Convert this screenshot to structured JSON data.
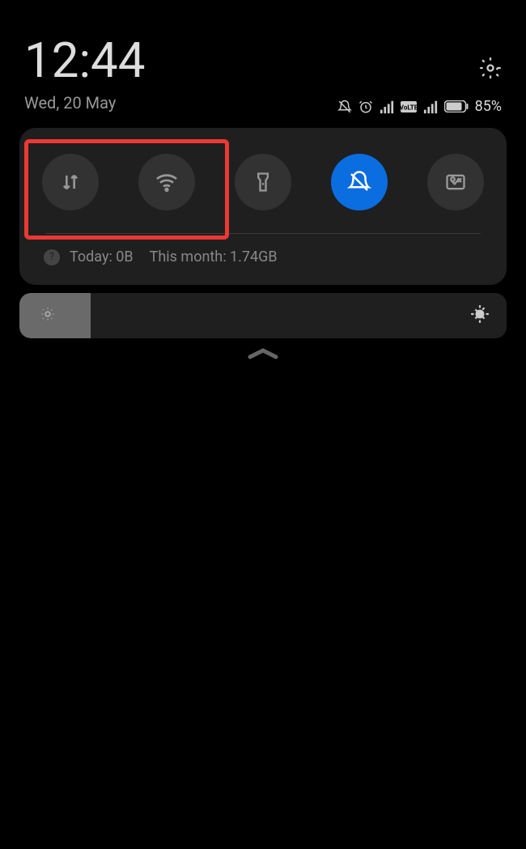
{
  "header": {
    "time": "12:44",
    "date": "Wed, 20 May"
  },
  "status": {
    "battery": "85%"
  },
  "toggles": {
    "mobile_data": {
      "active": false
    },
    "wifi": {
      "active": false
    },
    "flashlight": {
      "active": false
    },
    "dnd": {
      "active": true
    },
    "screenshot": {
      "active": false
    }
  },
  "usage": {
    "today_label": "Today: 0B",
    "month_label": "This month: 1.74GB"
  },
  "brightness": {
    "percent": 15
  }
}
